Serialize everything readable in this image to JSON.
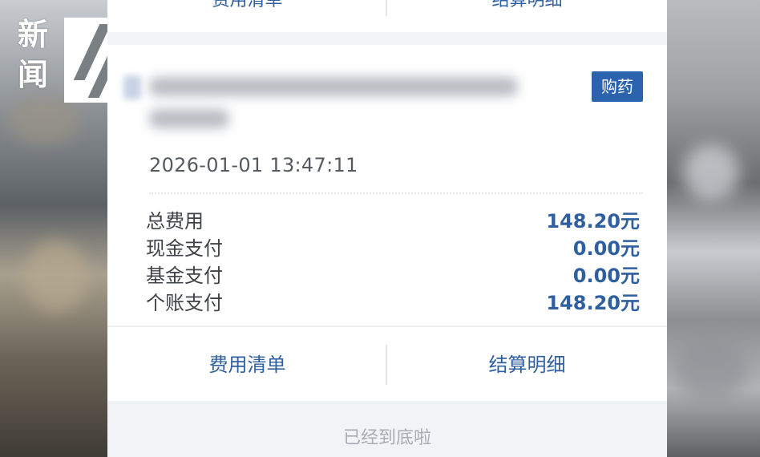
{
  "watermark": {
    "logo_text": "新闻"
  },
  "previous_card": {
    "left_button": "费用清单",
    "right_button": "结算明细"
  },
  "card": {
    "badge": "购药",
    "timestamp": "2026-01-01 13:47:11",
    "rows": [
      {
        "label": "总费用",
        "value": "148.20元"
      },
      {
        "label": "现金支付",
        "value": "0.00元"
      },
      {
        "label": "基金支付",
        "value": "0.00元"
      },
      {
        "label": "个账支付",
        "value": "148.20元"
      }
    ],
    "actions": {
      "left": "费用清单",
      "right": "结算明细"
    }
  },
  "footer": {
    "end_text": "已经到底啦"
  }
}
